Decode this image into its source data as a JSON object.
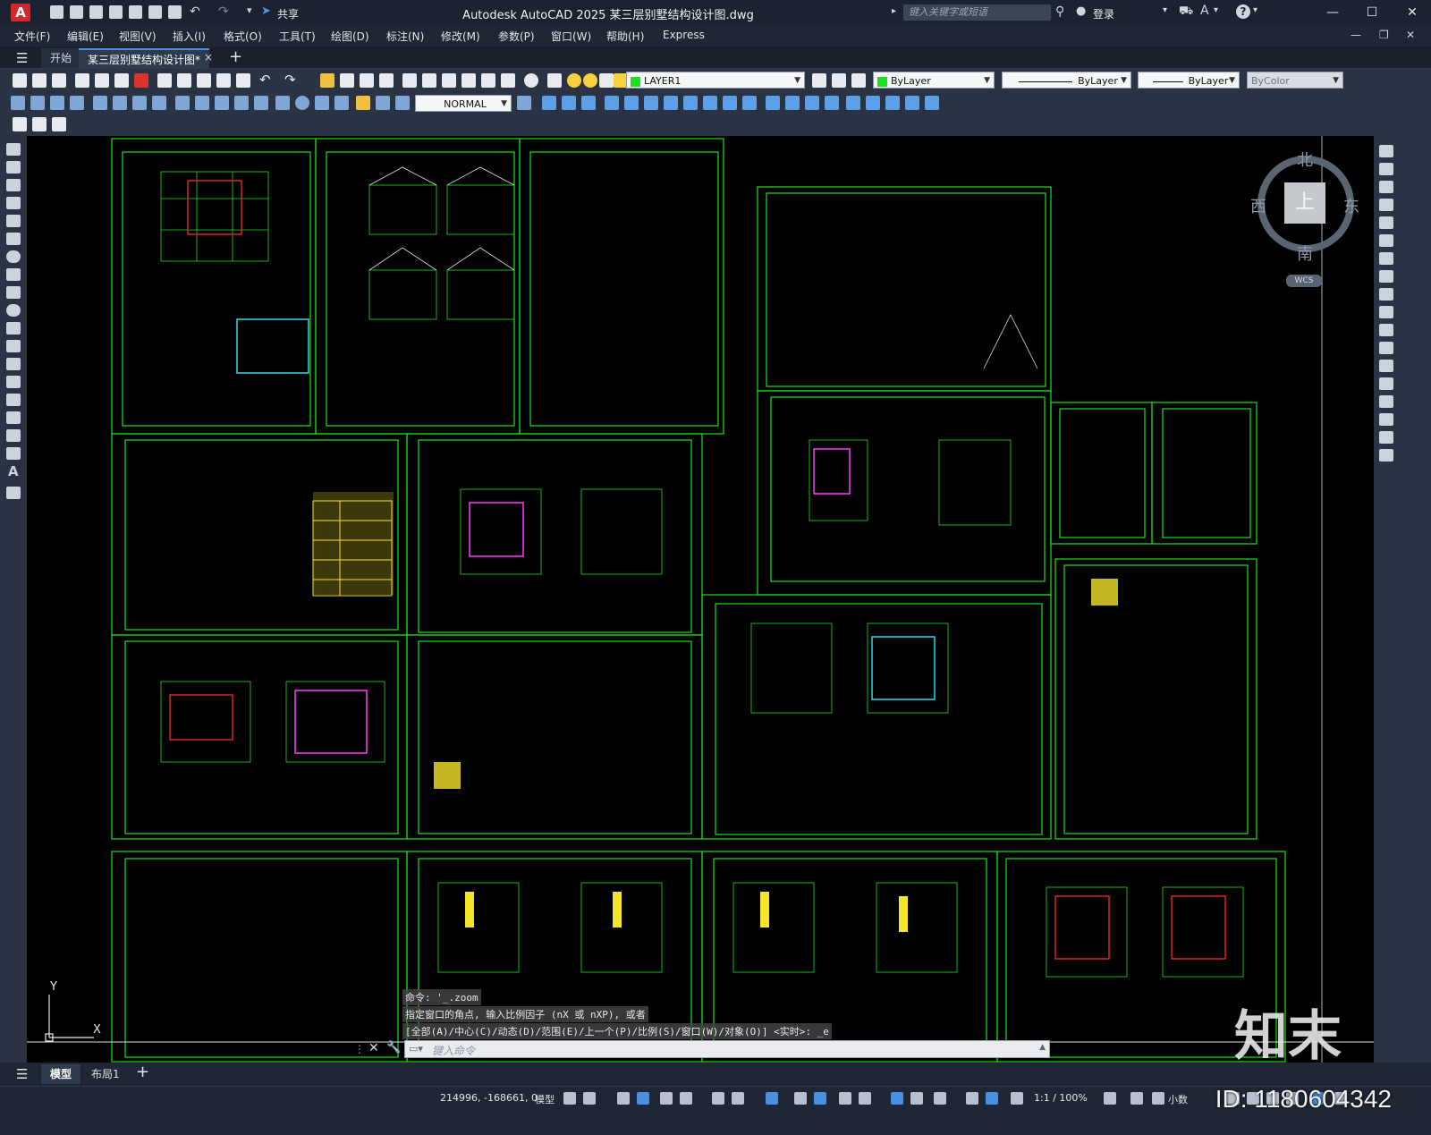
{
  "window": {
    "title": "Autodesk AutoCAD 2025    某三层别墅结构设计图.dwg",
    "app_logo": "A",
    "search_placeholder": "键入关键字或短语",
    "share_label": "共享",
    "login_label": "登录",
    "help_icon": "?"
  },
  "menu": {
    "items": [
      "文件(F)",
      "编辑(E)",
      "视图(V)",
      "插入(I)",
      "格式(O)",
      "工具(T)",
      "绘图(D)",
      "标注(N)",
      "修改(M)",
      "参数(P)",
      "窗口(W)",
      "帮助(H)",
      "Express"
    ]
  },
  "tabs": {
    "start": "开始",
    "drawing": "某三层别墅结构设计图*",
    "close": "×",
    "add": "+"
  },
  "toolbar": {
    "layer": "LAYER1",
    "color": "ByLayer",
    "linetype": "ByLayer",
    "lineweight": "ByLayer",
    "plotstyle": "ByColor",
    "dimstyle": "NORMAL"
  },
  "viewcube": {
    "north": "北",
    "south": "南",
    "east": "东",
    "west": "西",
    "top": "上",
    "wcs": "WCS"
  },
  "ucs": {
    "y": "Y",
    "x": "X"
  },
  "command": {
    "line1": "命令:  '_.zoom",
    "line2": "指定窗口的角点, 输入比例因子 (nX 或 nXP), 或者",
    "line3": "[全部(A)/中心(C)/动态(D)/范围(E)/上一个(P)/比例(S)/窗口(W)/对象(O)] <实时>: _e",
    "input_placeholder": "键入命令"
  },
  "layout_tabs": {
    "model": "模型",
    "layout1": "布局1",
    "add": "+"
  },
  "status": {
    "coords": "214996, -168661, 0",
    "model": "模型",
    "scale": "1:1 / 100%",
    "units": "小数"
  },
  "watermark": {
    "logo_text": "知末",
    "id_text": "ID: 1180604342"
  },
  "colors": {
    "canvas": "#000000",
    "drawing_lines": "#1ce11c",
    "accent": "#4b8ee2",
    "app_red": "#d4262e"
  }
}
